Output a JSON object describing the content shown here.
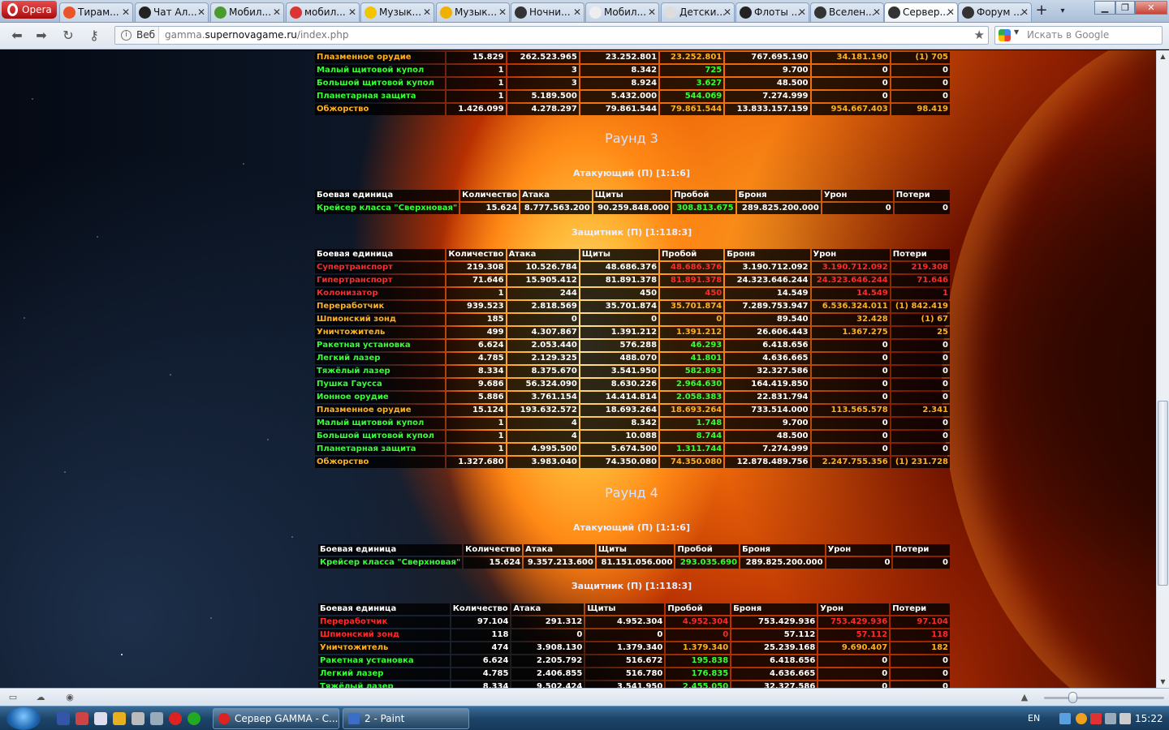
{
  "browser": {
    "menu_label": "Opera",
    "tabs": [
      {
        "title": "Тирам...",
        "active": false
      },
      {
        "title": "Чат Ал...",
        "active": false
      },
      {
        "title": "Мобил...",
        "active": false
      },
      {
        "title": "мобил...",
        "active": false
      },
      {
        "title": "Музык...",
        "active": false
      },
      {
        "title": "Музык...",
        "active": false
      },
      {
        "title": "Ночни...",
        "active": false
      },
      {
        "title": "Мобил...",
        "active": false
      },
      {
        "title": "Детски...",
        "active": false
      },
      {
        "title": "Флоты ...",
        "active": false
      },
      {
        "title": "Вселен...",
        "active": false
      },
      {
        "title": "Сервер...",
        "active": true
      },
      {
        "title": "Форум ...",
        "active": false
      }
    ],
    "tab_close": "✕",
    "new_tab": "+",
    "tab_menu": "▾",
    "window_buttons": {
      "min": "▁",
      "max": "❐",
      "close": "✕"
    },
    "url_scheme": "Веб",
    "url_prefix": "gamma.",
    "url_host": "supernovagame.ru",
    "url_path": "/index.php",
    "search_placeholder": "Искать в Google"
  },
  "colors": {
    "green": "#33ff33",
    "red": "#ff2a2a",
    "orange": "#ffb020",
    "white": "#ffffff"
  },
  "headers": [
    "Боевая единица",
    "Количество",
    "Атака",
    "Щиты",
    "Пробой",
    "Броня",
    "Урон",
    "Потери"
  ],
  "top_table": [
    {
      "name": "Плазменное орудие",
      "nc": "o",
      "cells": [
        "15.829",
        "262.523.965",
        "23.252.801",
        "23.252.801",
        "767.695.190",
        "34.181.190",
        "(1) 705"
      ],
      "cc": [
        "",
        "",
        "",
        "o",
        "",
        "o",
        "o"
      ]
    },
    {
      "name": "Малый щитовой купол",
      "nc": "g",
      "cells": [
        "1",
        "3",
        "8.342",
        "725",
        "9.700",
        "0",
        "0"
      ],
      "cc": [
        "",
        "",
        "",
        "g",
        "",
        "",
        ""
      ]
    },
    {
      "name": "Большой щитовой купол",
      "nc": "g",
      "cells": [
        "1",
        "3",
        "8.924",
        "3.627",
        "48.500",
        "0",
        "0"
      ],
      "cc": [
        "",
        "",
        "",
        "g",
        "",
        "",
        ""
      ]
    },
    {
      "name": "Планетарная защита",
      "nc": "g",
      "cells": [
        "1",
        "5.189.500",
        "5.432.000",
        "544.069",
        "7.274.999",
        "0",
        "0"
      ],
      "cc": [
        "",
        "",
        "",
        "g",
        "",
        "",
        ""
      ]
    },
    {
      "name": "Обжорство",
      "nc": "o",
      "cells": [
        "1.426.099",
        "4.278.297",
        "79.861.544",
        "79.861.544",
        "13.833.157.159",
        "954.667.403",
        "98.419"
      ],
      "cc": [
        "",
        "",
        "",
        "o",
        "",
        "o",
        "o"
      ]
    }
  ],
  "round3": {
    "title": "Раунд 3",
    "attacker_label": "Атакующий (П) [1:1:6]",
    "attacker": [
      {
        "name": "Крейсер класса \"Сверхновая\"",
        "nc": "g",
        "cells": [
          "15.624",
          "8.777.563.200",
          "90.259.848.000",
          "308.813.675",
          "289.825.200.000",
          "0",
          "0"
        ],
        "cc": [
          "",
          "",
          "",
          "g",
          "",
          "",
          ""
        ]
      }
    ],
    "defender_label": "Защитник (П) [1:118:3]",
    "defender": [
      {
        "name": "Супертранспорт",
        "nc": "r",
        "cells": [
          "219.308",
          "10.526.784",
          "48.686.376",
          "48.686.376",
          "3.190.712.092",
          "3.190.712.092",
          "219.308"
        ],
        "cc": [
          "",
          "",
          "",
          "r",
          "",
          "r",
          "r"
        ]
      },
      {
        "name": "Гипертранспорт",
        "nc": "r",
        "cells": [
          "71.646",
          "15.905.412",
          "81.891.378",
          "81.891.378",
          "24.323.646.244",
          "24.323.646.244",
          "71.646"
        ],
        "cc": [
          "",
          "",
          "",
          "r",
          "",
          "r",
          "r"
        ]
      },
      {
        "name": "Колонизатор",
        "nc": "r",
        "cells": [
          "1",
          "244",
          "450",
          "450",
          "14.549",
          "14.549",
          "1"
        ],
        "cc": [
          "",
          "",
          "",
          "r",
          "",
          "r",
          "r"
        ]
      },
      {
        "name": "Переработчик",
        "nc": "o",
        "cells": [
          "939.523",
          "2.818.569",
          "35.701.874",
          "35.701.874",
          "7.289.753.947",
          "6.536.324.011",
          "(1) 842.419"
        ],
        "cc": [
          "",
          "",
          "",
          "o",
          "",
          "o",
          "o"
        ]
      },
      {
        "name": "Шпионский зонд",
        "nc": "o",
        "cells": [
          "185",
          "0",
          "0",
          "0",
          "89.540",
          "32.428",
          "(1) 67"
        ],
        "cc": [
          "",
          "",
          "",
          "o",
          "",
          "o",
          "o"
        ]
      },
      {
        "name": "Уничтожитель",
        "nc": "o",
        "cells": [
          "499",
          "4.307.867",
          "1.391.212",
          "1.391.212",
          "26.606.443",
          "1.367.275",
          "25"
        ],
        "cc": [
          "",
          "",
          "",
          "o",
          "",
          "o",
          "o"
        ]
      },
      {
        "name": "Ракетная установка",
        "nc": "g",
        "cells": [
          "6.624",
          "2.053.440",
          "576.288",
          "46.293",
          "6.418.656",
          "0",
          "0"
        ],
        "cc": [
          "",
          "",
          "",
          "g",
          "",
          "",
          ""
        ]
      },
      {
        "name": "Легкий лазер",
        "nc": "g",
        "cells": [
          "4.785",
          "2.129.325",
          "488.070",
          "41.801",
          "4.636.665",
          "0",
          "0"
        ],
        "cc": [
          "",
          "",
          "",
          "g",
          "",
          "",
          ""
        ]
      },
      {
        "name": "Тяжёлый лазер",
        "nc": "g",
        "cells": [
          "8.334",
          "8.375.670",
          "3.541.950",
          "582.893",
          "32.327.586",
          "0",
          "0"
        ],
        "cc": [
          "",
          "",
          "",
          "g",
          "",
          "",
          ""
        ]
      },
      {
        "name": "Пушка Гаусса",
        "nc": "g",
        "cells": [
          "9.686",
          "56.324.090",
          "8.630.226",
          "2.964.630",
          "164.419.850",
          "0",
          "0"
        ],
        "cc": [
          "",
          "",
          "",
          "g",
          "",
          "",
          ""
        ]
      },
      {
        "name": "Ионное орудие",
        "nc": "g",
        "cells": [
          "5.886",
          "3.761.154",
          "14.414.814",
          "2.058.383",
          "22.831.794",
          "0",
          "0"
        ],
        "cc": [
          "",
          "",
          "",
          "g",
          "",
          "",
          ""
        ]
      },
      {
        "name": "Плазменное орудие",
        "nc": "o",
        "cells": [
          "15.124",
          "193.632.572",
          "18.693.264",
          "18.693.264",
          "733.514.000",
          "113.565.578",
          "2.341"
        ],
        "cc": [
          "",
          "",
          "",
          "o",
          "",
          "o",
          "o"
        ]
      },
      {
        "name": "Малый щитовой купол",
        "nc": "g",
        "cells": [
          "1",
          "4",
          "8.342",
          "1.748",
          "9.700",
          "0",
          "0"
        ],
        "cc": [
          "",
          "",
          "",
          "g",
          "",
          "",
          ""
        ]
      },
      {
        "name": "Большой щитовой купол",
        "nc": "g",
        "cells": [
          "1",
          "4",
          "10.088",
          "8.744",
          "48.500",
          "0",
          "0"
        ],
        "cc": [
          "",
          "",
          "",
          "g",
          "",
          "",
          ""
        ]
      },
      {
        "name": "Планетарная защита",
        "nc": "g",
        "cells": [
          "1",
          "4.995.500",
          "5.674.500",
          "1.311.744",
          "7.274.999",
          "0",
          "0"
        ],
        "cc": [
          "",
          "",
          "",
          "g",
          "",
          "",
          ""
        ]
      },
      {
        "name": "Обжорство",
        "nc": "o",
        "cells": [
          "1.327.680",
          "3.983.040",
          "74.350.080",
          "74.350.080",
          "12.878.489.756",
          "2.247.755.356",
          "(1) 231.728"
        ],
        "cc": [
          "",
          "",
          "",
          "o",
          "",
          "o",
          "o"
        ]
      }
    ]
  },
  "round4": {
    "title": "Раунд 4",
    "attacker_label": "Атакующий (П) [1:1:6]",
    "attacker": [
      {
        "name": "Крейсер класса \"Сверхновая\"",
        "nc": "g",
        "cells": [
          "15.624",
          "9.357.213.600",
          "81.151.056.000",
          "293.035.690",
          "289.825.200.000",
          "0",
          "0"
        ],
        "cc": [
          "",
          "",
          "",
          "g",
          "",
          "",
          ""
        ]
      }
    ],
    "defender_label": "Защитник (П) [1:118:3]",
    "defender": [
      {
        "name": "Переработчик",
        "nc": "r",
        "cells": [
          "97.104",
          "291.312",
          "4.952.304",
          "4.952.304",
          "753.429.936",
          "753.429.936",
          "97.104"
        ],
        "cc": [
          "",
          "",
          "",
          "r",
          "",
          "r",
          "r"
        ]
      },
      {
        "name": "Шпионский зонд",
        "nc": "r",
        "cells": [
          "118",
          "0",
          "0",
          "0",
          "57.112",
          "57.112",
          "118"
        ],
        "cc": [
          "",
          "",
          "",
          "r",
          "",
          "r",
          "r"
        ]
      },
      {
        "name": "Уничтожитель",
        "nc": "o",
        "cells": [
          "474",
          "3.908.130",
          "1.379.340",
          "1.379.340",
          "25.239.168",
          "9.690.407",
          "182"
        ],
        "cc": [
          "",
          "",
          "",
          "o",
          "",
          "o",
          "o"
        ]
      },
      {
        "name": "Ракетная установка",
        "nc": "g",
        "cells": [
          "6.624",
          "2.205.792",
          "516.672",
          "195.838",
          "6.418.656",
          "0",
          "0"
        ],
        "cc": [
          "",
          "",
          "",
          "g",
          "",
          "",
          ""
        ]
      },
      {
        "name": "Легкий лазер",
        "nc": "g",
        "cells": [
          "4.785",
          "2.406.855",
          "516.780",
          "176.835",
          "4.636.665",
          "0",
          "0"
        ],
        "cc": [
          "",
          "",
          "",
          "g",
          "",
          "",
          ""
        ]
      },
      {
        "name": "Тяжёлый лазер",
        "nc": "g",
        "cells": [
          "8.334",
          "9.502.424",
          "3.541.950",
          "2.455.050",
          "32.327.586",
          "0",
          "0"
        ],
        "cc": [
          "",
          "",
          "",
          "g",
          "",
          "",
          ""
        ]
      }
    ]
  },
  "taskbar": {
    "tasks": [
      "Сервер GAMMA - С...",
      "2 - Paint"
    ],
    "lang": "EN",
    "clock": "15:22"
  }
}
